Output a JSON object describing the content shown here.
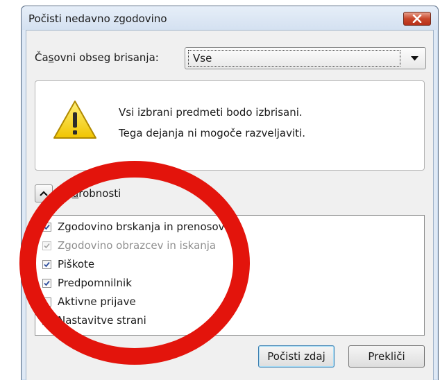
{
  "dialog": {
    "title": "Počisti nedavno zgodovino",
    "time_range": {
      "label_before": "Ča",
      "label_access_key": "s",
      "label_after": "ovni obseg brisanja:",
      "selected": "Vse"
    },
    "warning": {
      "line1": "Vsi izbrani predmeti bodo izbrisani.",
      "line2": "Tega dejanja ni mogoče razveljaviti."
    },
    "details": {
      "label_before": "Po",
      "label_access_key": "d",
      "label_after": "robnosti",
      "expanded": true
    },
    "items": [
      {
        "label": "Zgodovino brskanja in prenosov",
        "checked": true,
        "enabled": true
      },
      {
        "label": "Zgodovino obrazcev in iskanja",
        "checked": true,
        "enabled": false
      },
      {
        "label": "Piškote",
        "checked": true,
        "enabled": true
      },
      {
        "label": "Predpomnilnik",
        "checked": true,
        "enabled": true
      },
      {
        "label": "Aktivne prijave",
        "checked": false,
        "enabled": true
      },
      {
        "label": "Nastavitve strani",
        "checked": false,
        "enabled": true
      }
    ],
    "buttons": {
      "clear_now": "Počisti zdaj",
      "cancel": "Prekliči"
    }
  },
  "colors": {
    "annotation_circle": "#e3140c",
    "checkmark": "#2c4c9c",
    "warning_yellow": "#f5d200"
  }
}
